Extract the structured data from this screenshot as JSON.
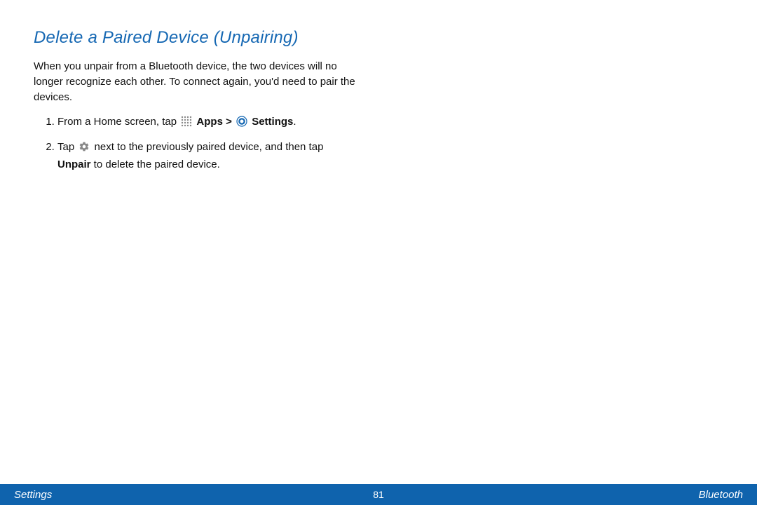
{
  "heading": "Delete a Paired Device (Unpairing)",
  "intro": "When you unpair from a Bluetooth device, the two devices will no longer recognize each other. To connect again, you'd need to pair the devices.",
  "steps": {
    "s1_a": "From a Home screen, tap ",
    "s1_apps": "Apps > ",
    "s1_settings": "Settings",
    "s1_end": ".",
    "s2_a": "Tap ",
    "s2_b": " next to the previously paired device, and then tap ",
    "s2_unpair": "Unpair",
    "s2_c": " to delete the paired device."
  },
  "footer": {
    "left": "Settings",
    "center": "81",
    "right": "Bluetooth"
  }
}
